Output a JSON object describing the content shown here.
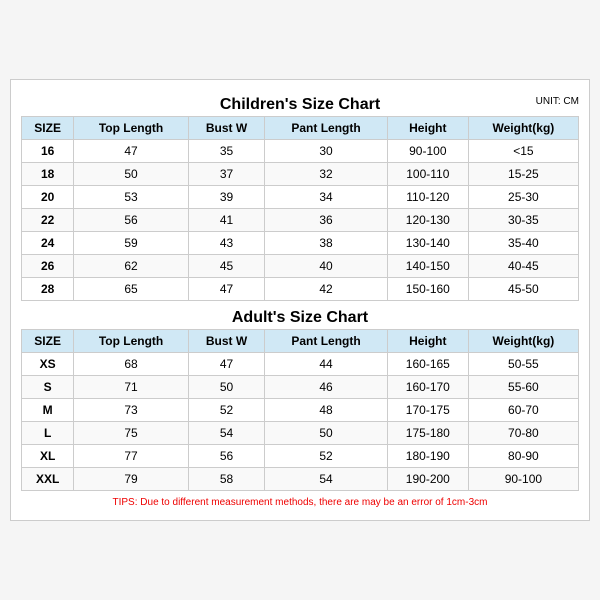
{
  "children_title": "Children's Size Chart",
  "unit_label": "UNIT: CM",
  "children_headers": [
    "SIZE",
    "Top Length",
    "Bust W",
    "Pant Length",
    "Height",
    "Weight(kg)"
  ],
  "children_rows": [
    [
      "16",
      "47",
      "35",
      "30",
      "90-100",
      "<15"
    ],
    [
      "18",
      "50",
      "37",
      "32",
      "100-110",
      "15-25"
    ],
    [
      "20",
      "53",
      "39",
      "34",
      "110-120",
      "25-30"
    ],
    [
      "22",
      "56",
      "41",
      "36",
      "120-130",
      "30-35"
    ],
    [
      "24",
      "59",
      "43",
      "38",
      "130-140",
      "35-40"
    ],
    [
      "26",
      "62",
      "45",
      "40",
      "140-150",
      "40-45"
    ],
    [
      "28",
      "65",
      "47",
      "42",
      "150-160",
      "45-50"
    ]
  ],
  "adult_title": "Adult's Size Chart",
  "adult_headers": [
    "SIZE",
    "Top Length",
    "Bust W",
    "Pant Length",
    "Height",
    "Weight(kg)"
  ],
  "adult_rows": [
    [
      "XS",
      "68",
      "47",
      "44",
      "160-165",
      "50-55"
    ],
    [
      "S",
      "71",
      "50",
      "46",
      "160-170",
      "55-60"
    ],
    [
      "M",
      "73",
      "52",
      "48",
      "170-175",
      "60-70"
    ],
    [
      "L",
      "75",
      "54",
      "50",
      "175-180",
      "70-80"
    ],
    [
      "XL",
      "77",
      "56",
      "52",
      "180-190",
      "80-90"
    ],
    [
      "XXL",
      "79",
      "58",
      "54",
      "190-200",
      "90-100"
    ]
  ],
  "tips": "TIPS: Due to different measurement methods, there are may be an error of 1cm-3cm"
}
